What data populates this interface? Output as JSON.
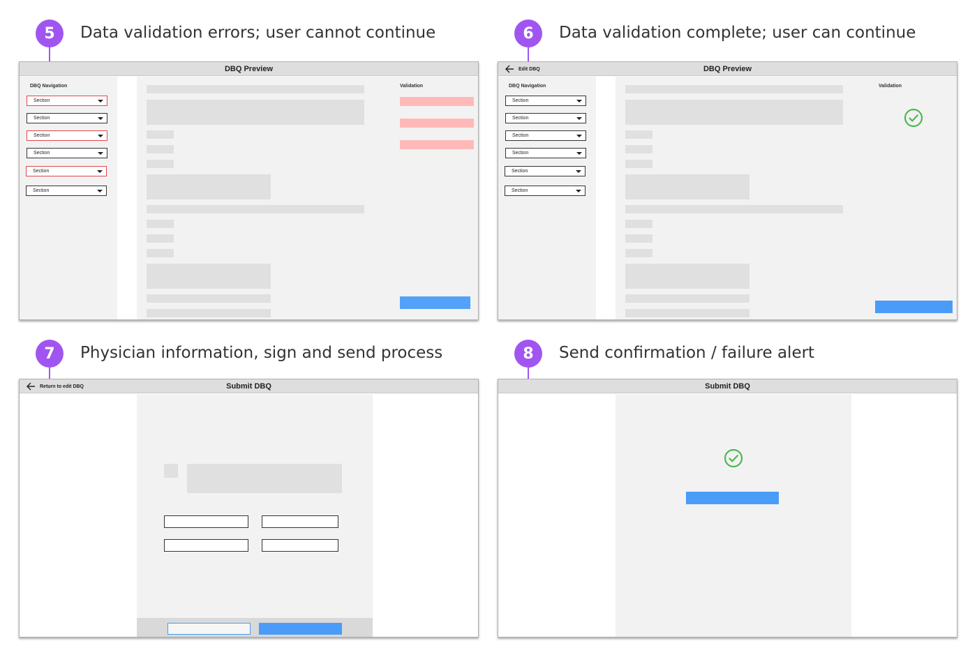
{
  "steps": [
    {
      "number": "5",
      "title": "Data validation errors; user cannot continue"
    },
    {
      "number": "6",
      "title": "Data validation complete; user can continue"
    },
    {
      "number": "7",
      "title": "Physician information, sign and send process"
    },
    {
      "number": "8",
      "title": "Send confirmation / failure alert"
    }
  ],
  "screens": {
    "preview_errors": {
      "title": "DBQ Preview",
      "nav_label": "DBQ Navigation",
      "validation_label": "Validation",
      "sections": [
        {
          "label": "Section",
          "error": true
        },
        {
          "label": "Section",
          "error": false
        },
        {
          "label": "Section",
          "error": true
        },
        {
          "label": "Section",
          "error": false
        },
        {
          "label": "Section",
          "error": true
        },
        {
          "label": "Section",
          "error": false
        }
      ]
    },
    "preview_complete": {
      "title": "DBQ Preview",
      "back_label": "Edit DBQ",
      "nav_label": "DBQ Navigation",
      "validation_label": "Validation",
      "sections": [
        {
          "label": "Section"
        },
        {
          "label": "Section"
        },
        {
          "label": "Section"
        },
        {
          "label": "Section"
        },
        {
          "label": "Section"
        },
        {
          "label": "Section"
        }
      ]
    },
    "submit": {
      "title": "Submit DBQ",
      "back_label": "Return to edit DBQ"
    },
    "confirmation": {
      "title": "Submit DBQ"
    }
  },
  "colors": {
    "badge": "#a155f0",
    "primary_button": "#4a9cf8",
    "error_border": "#e0474c",
    "error_fill": "#ffb9b9",
    "success": "#4cb94f"
  }
}
